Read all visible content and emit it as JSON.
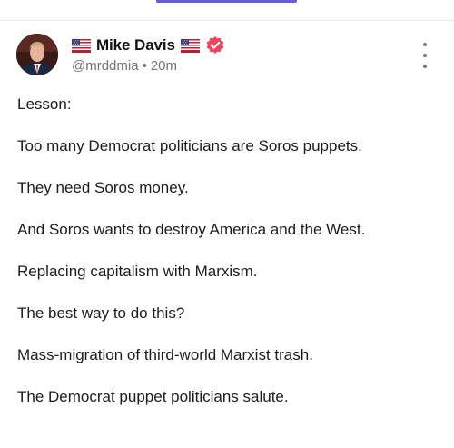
{
  "tabs": {
    "active_color": "#6a5ad8"
  },
  "post": {
    "author": {
      "display_name": "Mike Davis",
      "handle": "@mrddmia",
      "time_ago": "20m",
      "separator": "•",
      "verified_color": "#e8475f",
      "flag_icon": "us-flag-icon"
    },
    "paragraphs": [
      "Lesson:",
      "Too many Democrat politicians are Soros puppets.",
      "They need Soros money.",
      "And Soros wants to destroy America and the West.",
      "Replacing capitalism with Marxism.",
      "The best way to do this?",
      "Mass-migration of third-world Marxist trash.",
      "The Democrat puppet politicians salute."
    ]
  }
}
